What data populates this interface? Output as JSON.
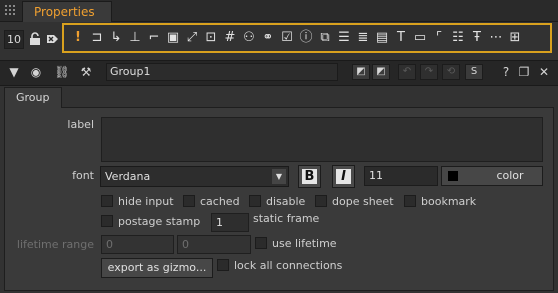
{
  "window": {
    "tab_title": "Properties"
  },
  "toolbar": {
    "node_count": "10",
    "tools": [
      {
        "icon": "exclamation-icon",
        "glyph": "!"
      },
      {
        "icon": "branch-icon",
        "glyph": "⊐"
      },
      {
        "icon": "axis-corner-icon",
        "glyph": "↳"
      },
      {
        "icon": "axis-xy-icon",
        "glyph": "⊥"
      },
      {
        "icon": "crop-corner-icon",
        "glyph": "⌐"
      },
      {
        "icon": "select-box-icon",
        "glyph": "▣"
      },
      {
        "icon": "resize-icon",
        "glyph": "⤢"
      },
      {
        "icon": "uv-icon",
        "glyph": "⊡"
      },
      {
        "icon": "hash-icon",
        "glyph": "#"
      },
      {
        "icon": "color-circles-icon",
        "glyph": "⚇"
      },
      {
        "icon": "triple-circles-icon",
        "glyph": "⚭"
      },
      {
        "icon": "checkbox-icon",
        "glyph": "☑"
      },
      {
        "icon": "info-icon",
        "glyph": "ⓘ"
      },
      {
        "icon": "swap-icon",
        "glyph": "⧉"
      },
      {
        "icon": "align-left-icon",
        "glyph": "☰"
      },
      {
        "icon": "list-icon",
        "glyph": "≣"
      },
      {
        "icon": "document-icon",
        "glyph": "▤"
      },
      {
        "icon": "text-box-icon",
        "glyph": "T"
      },
      {
        "icon": "frame-icon",
        "glyph": "▭"
      },
      {
        "icon": "corner-flag-icon",
        "glyph": "⌜"
      },
      {
        "icon": "list-dropdown-icon",
        "glyph": "☷"
      },
      {
        "icon": "text-size-icon",
        "glyph": "Ŧ"
      },
      {
        "icon": "dashes-icon",
        "glyph": "⋯"
      },
      {
        "icon": "nodes-icon",
        "glyph": "⊞"
      }
    ]
  },
  "node": {
    "name": "Group1"
  },
  "tabs": {
    "group": "Group"
  },
  "fields": {
    "label": "label",
    "font_label": "font",
    "font_value": "Verdana",
    "bold": "B",
    "italic": "I",
    "font_size": "11",
    "color_button": "color",
    "hide_input": "hide input",
    "cached": "cached",
    "disable": "disable",
    "dope_sheet": "dope sheet",
    "bookmark": "bookmark",
    "postage_stamp": "postage stamp",
    "static_frame_value": "1",
    "static_frame": "static frame",
    "lifetime_range": "lifetime range",
    "lifetime_start": "0",
    "lifetime_end": "0",
    "use_lifetime": "use lifetime",
    "export_button": "export as gizmo...",
    "lock_connections": "lock all connections"
  },
  "colors": {
    "accent": "#f0a030",
    "toolbar_highlight": "#d9a11e"
  }
}
